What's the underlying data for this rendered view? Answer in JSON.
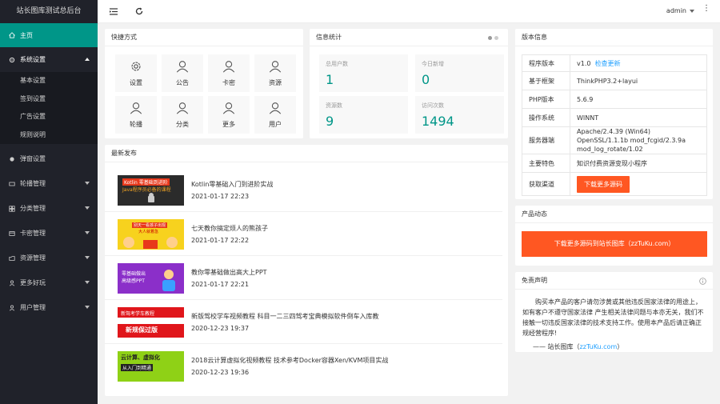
{
  "app": {
    "title": "站长图库测试总后台"
  },
  "sidebar": {
    "home": "主页",
    "system": "系统设置",
    "sub": [
      "基本设置",
      "签到设置",
      "广告设置",
      "规则说明"
    ],
    "items": [
      "弹窗设置",
      "轮播管理",
      "分类管理",
      "卡密管理",
      "资源管理",
      "更多好玩",
      "用户管理"
    ]
  },
  "topbar": {
    "user": "admin"
  },
  "quick": {
    "title": "快捷方式",
    "items": [
      "设置",
      "公告",
      "卡密",
      "资源",
      "轮播",
      "分类",
      "更多",
      "用户"
    ]
  },
  "stats": {
    "title": "信息统计",
    "items": [
      {
        "label": "总用户数",
        "value": "1"
      },
      {
        "label": "今日新增",
        "value": "0"
      },
      {
        "label": "资源数",
        "value": "9"
      },
      {
        "label": "访问次数",
        "value": "1494"
      }
    ]
  },
  "latest": {
    "title": "最新发布",
    "posts": [
      {
        "title": "Kotlin零基础入门到进阶实战",
        "date": "2021-01-17 22:23",
        "thumb_text_1": "Kotlin 零基础到进阶",
        "thumb_text_2": "Java程序员必备的课程",
        "bg": "#2b2b2b"
      },
      {
        "title": "七天教你搞定烦人的熊孩子",
        "date": "2021-01-17 22:22",
        "thumb_text_1": "别天一看孩子出现",
        "thumb_text_2": "大人就着急",
        "bg": "#f7d21e"
      },
      {
        "title": "教你零基础做出高大上PPT",
        "date": "2021-01-17 22:21",
        "thumb_text_1": "零基础做出",
        "thumb_text_2": "高级感PPT",
        "bg": "#8b2fc9"
      },
      {
        "title": "新版驾校学车视频教程 科目一二三四驾考宝典模拟软件倒车入库教",
        "date": "2020-12-23 19:37",
        "thumb_text_1": "新驾考学车教程",
        "thumb_text_2": "新规保过版",
        "bg": "#e0161b"
      },
      {
        "title": "2018云计算虚拟化视频教程 技术参考Docker容器Xen/KVM项目实战",
        "date": "2020-12-23 19:36",
        "thumb_text_1": "云计算、虚拟化",
        "thumb_text_2": "从入门到精通",
        "bg": "#8fd116"
      }
    ]
  },
  "version": {
    "title": "版本信息",
    "rows": [
      {
        "k": "程序版本",
        "v": "v1.0",
        "link": "检查更新"
      },
      {
        "k": "基于框架",
        "v": "ThinkPHP3.2+layui"
      },
      {
        "k": "PHP版本",
        "v": "5.6.9"
      },
      {
        "k": "操作系统",
        "v": "WINNT"
      },
      {
        "k": "服务器端",
        "v": "Apache/2.4.39 (Win64) OpenSSL/1.1.1b mod_fcgid/2.3.9a mod_log_rotate/1.02"
      },
      {
        "k": "主要特色",
        "v": "知识付费资源变现小程序"
      },
      {
        "k": "获取渠道",
        "btn": "下载更多源码"
      }
    ]
  },
  "product": {
    "title": "产品动态",
    "button": "下载更多源码到站长图库（zzTuKu.com）"
  },
  "disclaimer": {
    "title": "免责声明",
    "text": "购买本产品的客户请勿涉黄或其他违反国家法律的用途上，如有客户不遵守国家法律 产生相关法律问题与本亦无关，我们不接触一切违反国家法律的技术支持工作。使用本产品后请正确正规经营程序!",
    "foot_prefix": "—— 站长图库（",
    "foot_link": "zzTuKu.com",
    "foot_suffix": "）"
  },
  "colors": {
    "accent": "#009688",
    "orange": "#ff5722",
    "sidebar": "#20222a",
    "link": "#1e9fff"
  }
}
